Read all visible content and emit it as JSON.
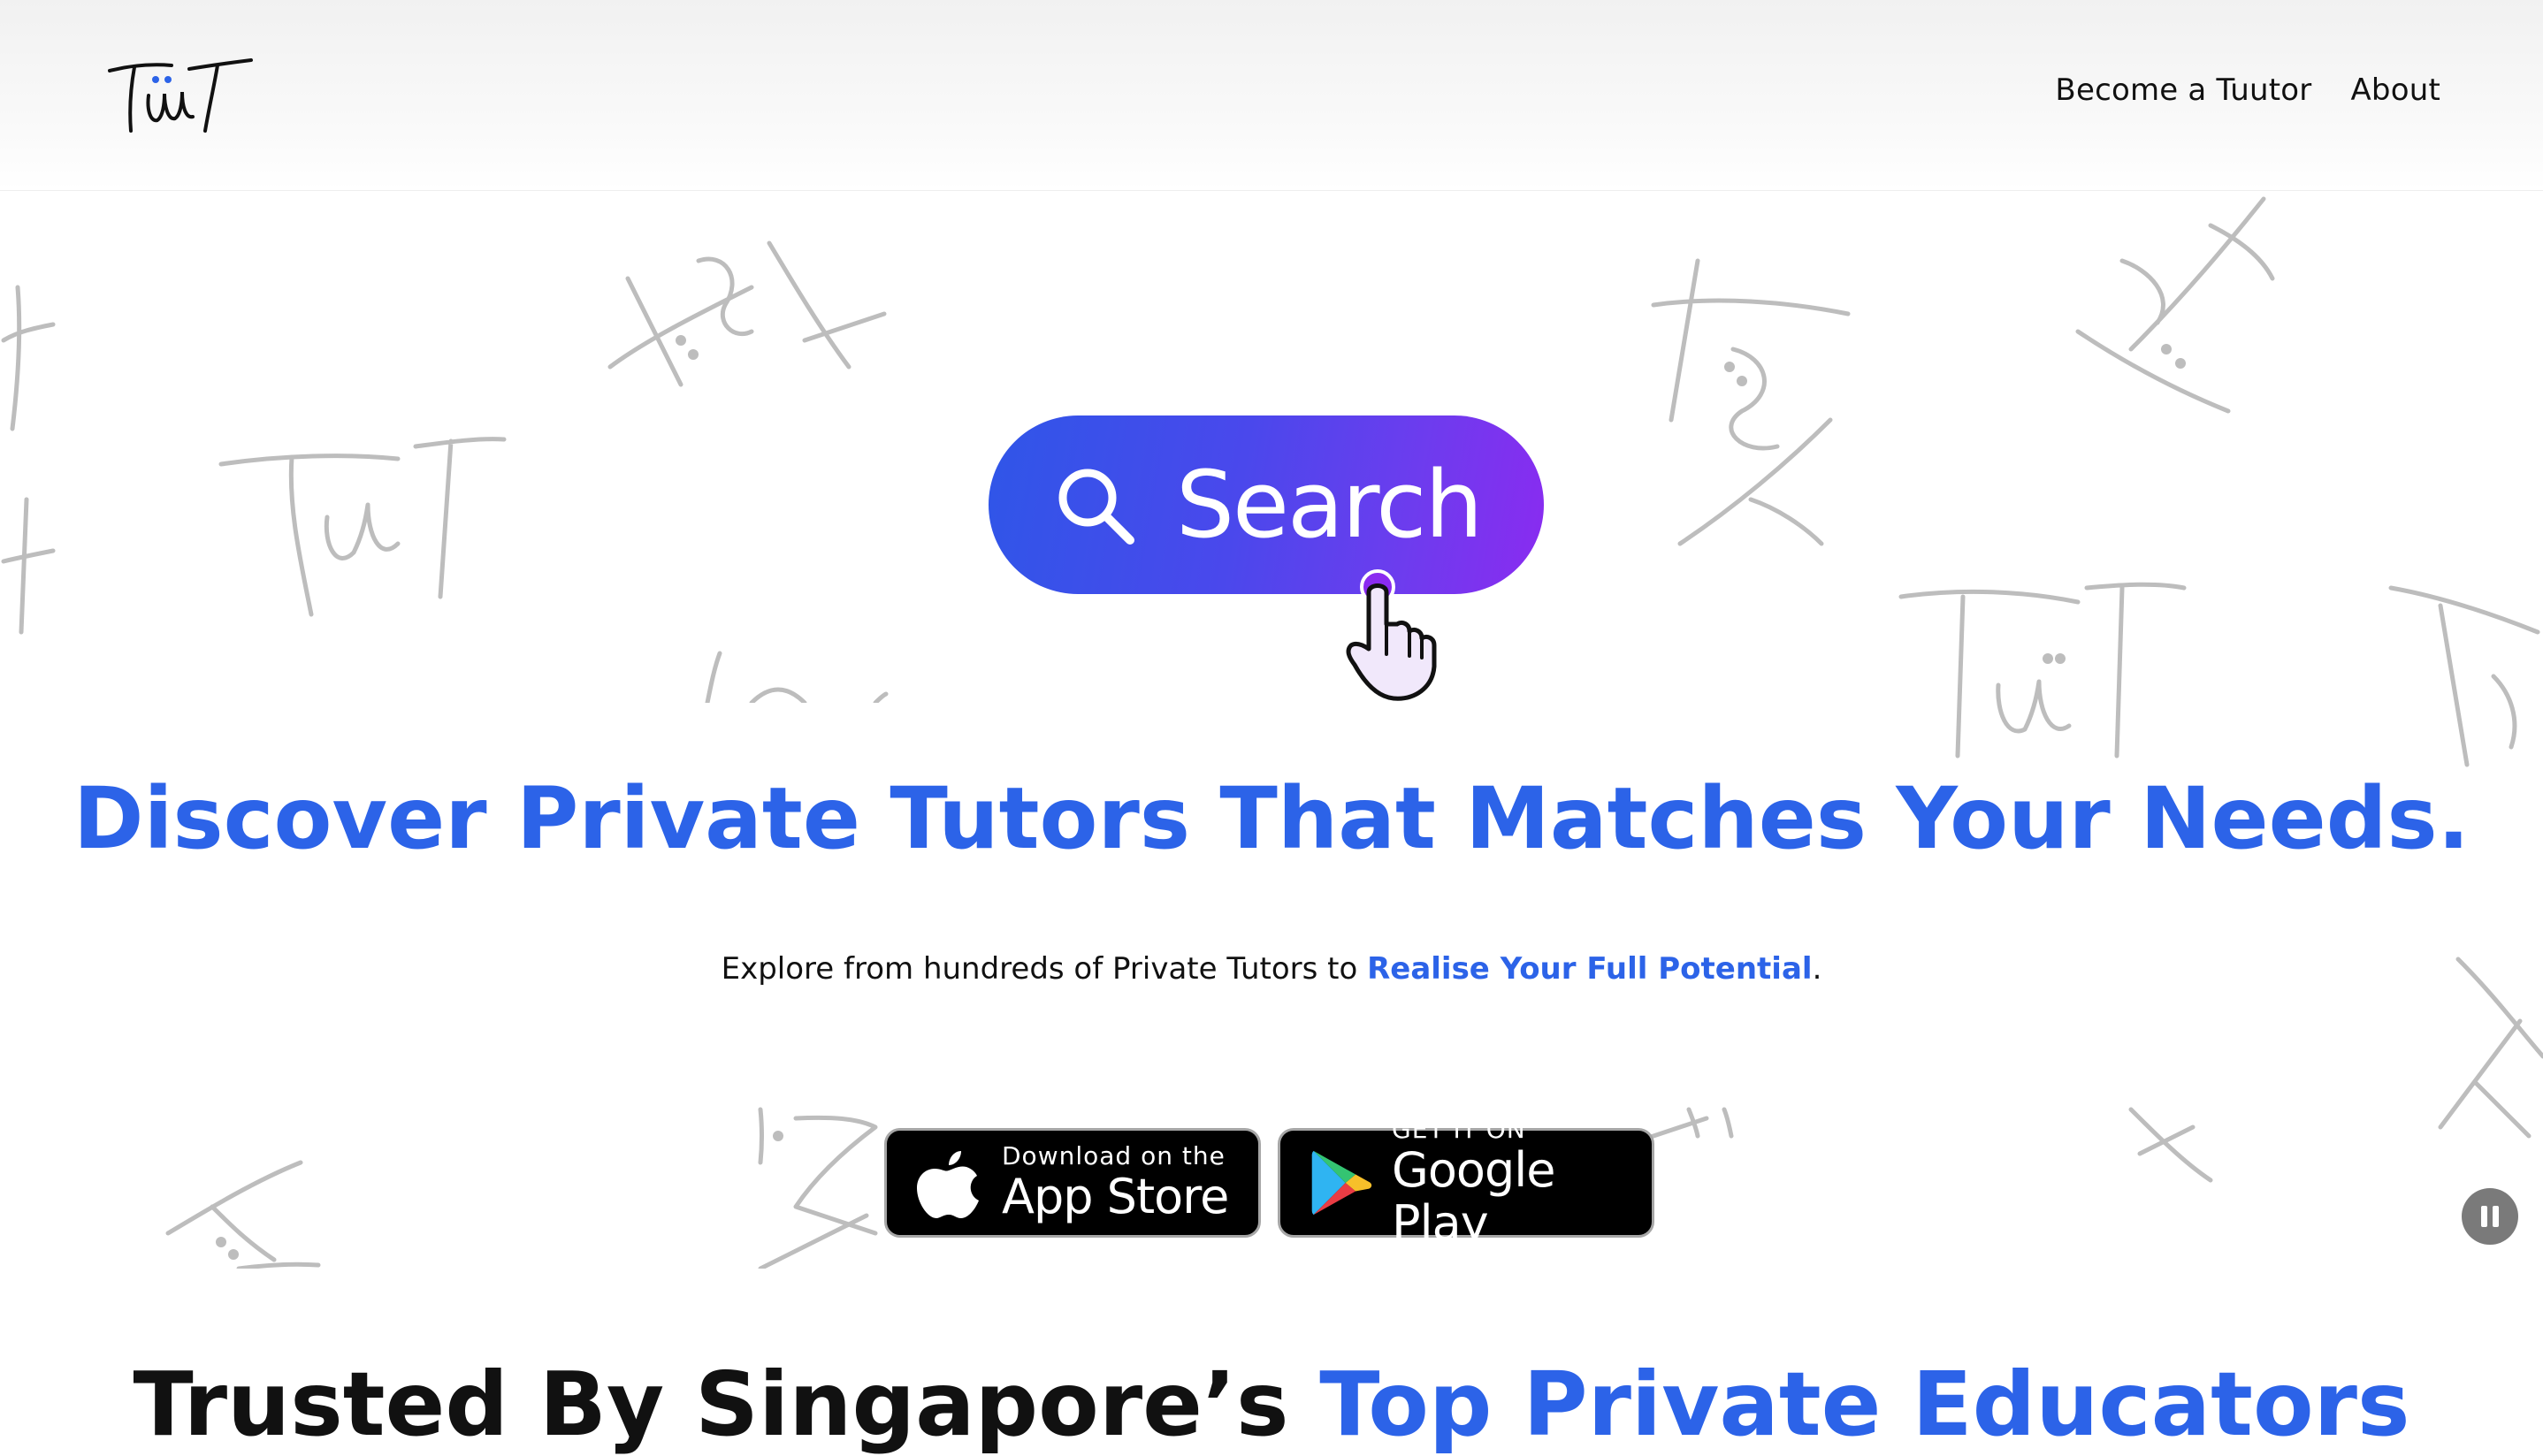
{
  "header": {
    "logo_text": "Tüut",
    "nav": [
      {
        "label": "Become a Tuutor"
      },
      {
        "label": "About"
      }
    ]
  },
  "hero": {
    "search_label": "Search",
    "headline": "Discover Private Tutors That Matches Your Needs.",
    "subline_prefix": "Explore from hundreds of Private Tutors to ",
    "subline_link": "Realise Your Full Potential",
    "subline_suffix": "."
  },
  "stores": {
    "appstore": {
      "small": "Download on the",
      "big": "App Store"
    },
    "googleplay": {
      "small": "GET IT ON",
      "big": "Google Play"
    }
  },
  "section": {
    "heading_prefix": "Trusted By Singapore’s ",
    "heading_accent": "Top Private Educators"
  },
  "colors": {
    "brand_blue": "#2c63e8",
    "search_gradient_start": "#2f56e8",
    "search_gradient_end": "#8a2bf0",
    "doodle_gray": "#bdbdbd"
  },
  "icons": {
    "search": "search-icon",
    "pointer": "hand-pointer-icon",
    "apple": "apple-icon",
    "play": "google-play-icon",
    "pause": "pause-icon"
  }
}
